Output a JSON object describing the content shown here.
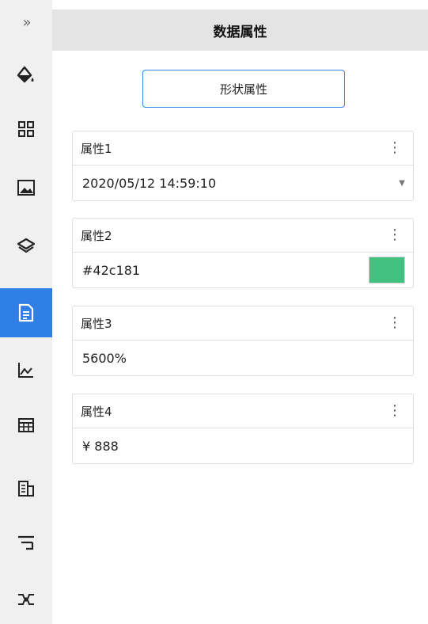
{
  "sidebar": {
    "expand_glyph": "»",
    "items": [
      {
        "icon": "paint-bucket-icon"
      },
      {
        "icon": "grid-apps-icon"
      },
      {
        "icon": "image-icon"
      },
      {
        "icon": "layers-icon"
      },
      {
        "icon": "data-document-icon",
        "active": true
      },
      {
        "icon": "line-chart-icon"
      },
      {
        "icon": "table-icon"
      },
      {
        "icon": "building-icon"
      },
      {
        "icon": "hierarchy-icon"
      },
      {
        "icon": "network-icon"
      }
    ],
    "active_color": "#2f7fe6"
  },
  "panel": {
    "title": "数据属性",
    "shape_button_label": "形状属性",
    "properties": [
      {
        "name": "属性1",
        "value": "2020/05/12 14:59:10",
        "type": "datetime-select"
      },
      {
        "name": "属性2",
        "value": "#42c181",
        "type": "color",
        "swatch_color": "#42c181"
      },
      {
        "name": "属性3",
        "value": "5600%",
        "type": "percent"
      },
      {
        "name": "属性4",
        "value": "¥ 888",
        "type": "currency"
      }
    ]
  }
}
